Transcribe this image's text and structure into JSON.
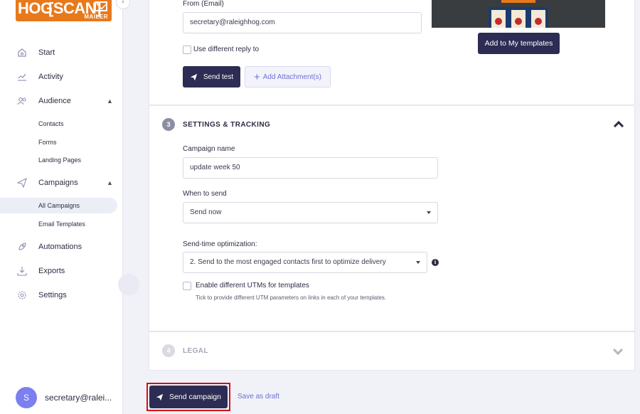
{
  "brand": {
    "part1": "HOG",
    "part2": "[SCAN]",
    "sub": "MAILER"
  },
  "sidebar": {
    "items": [
      {
        "label": "Start"
      },
      {
        "label": "Activity"
      },
      {
        "label": "Audience"
      },
      {
        "label": "Contacts"
      },
      {
        "label": "Forms"
      },
      {
        "label": "Landing Pages"
      },
      {
        "label": "Campaigns"
      },
      {
        "label": "All Campaigns"
      },
      {
        "label": "Email Templates"
      },
      {
        "label": "Automations"
      },
      {
        "label": "Exports"
      },
      {
        "label": "Settings"
      }
    ],
    "user": {
      "initial": "S",
      "email": "secretary@ralei..."
    }
  },
  "sender": {
    "from_label": "From (Email)",
    "from_value": "secretary@raleighhog.com",
    "reply_label": "Use different reply to",
    "send_test": "Send test",
    "add_attachment": "Add Attachment(s)",
    "add_to_templates": "Add to My templates"
  },
  "settings": {
    "step": "3",
    "title": "SETTINGS & TRACKING",
    "campaign_name_label": "Campaign name",
    "campaign_name_value": "update week 50",
    "when_label": "When to send",
    "when_value": "Send now",
    "sto_label": "Send-time optimization:",
    "sto_value": "2. Send to the most engaged contacts first to optimize delivery",
    "utm_label": "Enable different UTMs for templates",
    "utm_help": "Tick to provide different UTM parameters on links in each of your templates."
  },
  "legal": {
    "step": "4",
    "title": "LEGAL"
  },
  "footer": {
    "send_campaign": "Send campaign",
    "save_draft": "Save as draft"
  },
  "colors": {
    "primary": "#2c2c54",
    "accent": "#6f6fd6",
    "brand": "#e8791b",
    "highlight": "#d0101a"
  }
}
